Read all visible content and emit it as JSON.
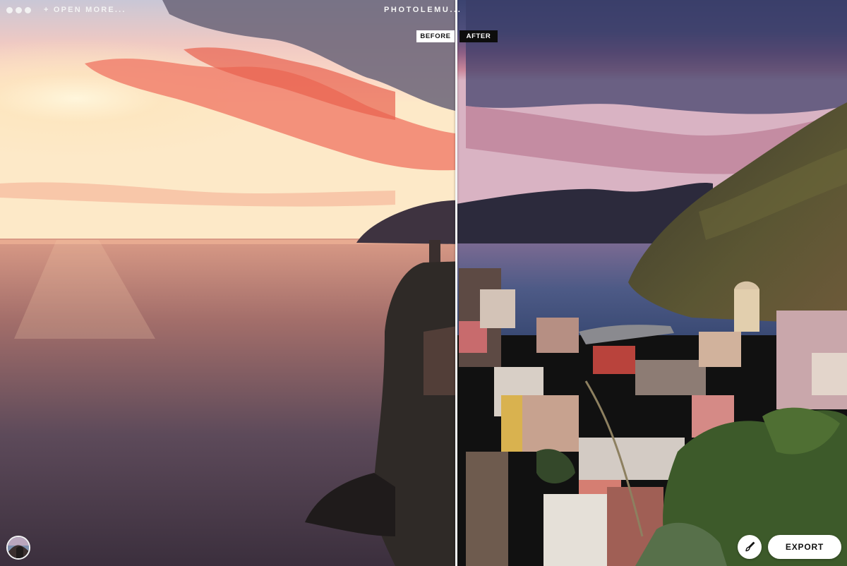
{
  "window": {
    "app_title": "PHOTOLEMU...",
    "open_more_label": "+ OPEN MORE..."
  },
  "comparison": {
    "before_label": "BEFORE",
    "after_label": "AFTER"
  },
  "toolbar": {
    "export_label": "EXPORT",
    "brush_icon": "brush-icon"
  },
  "colors": {
    "accent": "#ffffff",
    "before_sky": "#f6b39e",
    "after_sky": "#4a4f7a"
  }
}
